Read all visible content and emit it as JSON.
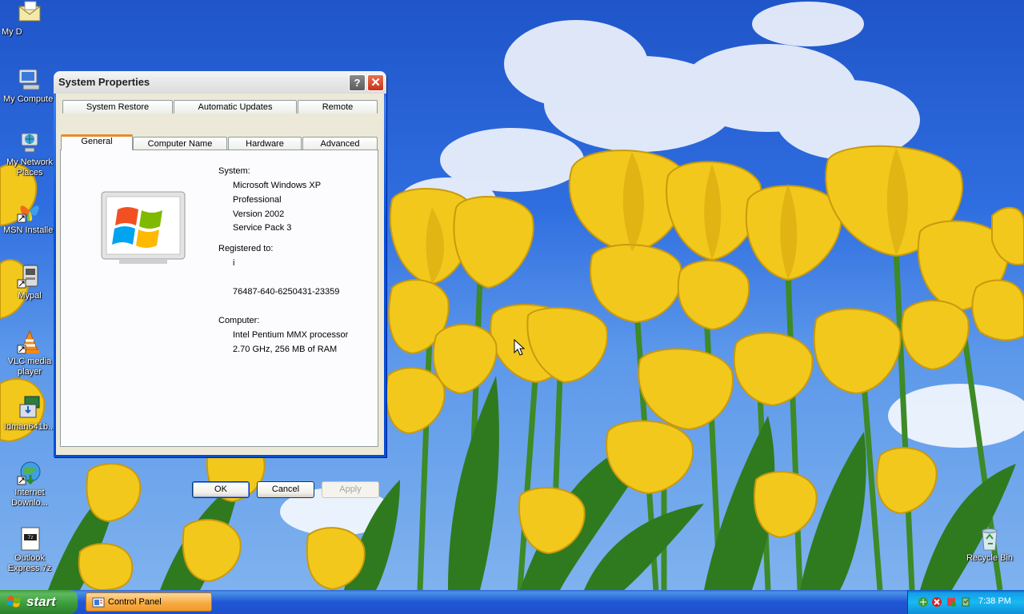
{
  "desktop": {
    "icons": [
      {
        "label": "My D"
      },
      {
        "label": "My Computer"
      },
      {
        "label": "My Network Places"
      },
      {
        "label": "MSN Installer"
      },
      {
        "label": "Mypal"
      },
      {
        "label": "VLC media player"
      },
      {
        "label": "Idman641b..."
      },
      {
        "label": "Internet Downlo..."
      },
      {
        "label": "Outlook Express.7z"
      },
      {
        "label": "Recycle Bin"
      }
    ]
  },
  "dialog": {
    "title": "System Properties",
    "help_label": "?",
    "close_label": "✕",
    "tabs_row1": [
      "System Restore",
      "Automatic Updates",
      "Remote"
    ],
    "tabs_row2": [
      "General",
      "Computer Name",
      "Hardware",
      "Advanced"
    ],
    "active_tab": "General",
    "system_heading": "System:",
    "system_lines": [
      "Microsoft Windows XP",
      "Professional",
      "Version 2002",
      "Service Pack 3"
    ],
    "registered_heading": "Registered to:",
    "registered_name": "i",
    "product_id": "76487-640-6250431-23359",
    "computer_heading": "Computer:",
    "computer_lines": [
      "Intel Pentium MMX processor",
      "2.70 GHz, 256 MB of RAM"
    ],
    "buttons": {
      "ok": "OK",
      "cancel": "Cancel",
      "apply": "Apply"
    }
  },
  "taskbar": {
    "start_label": "start",
    "task_label": "Control Panel",
    "clock": "7:38 PM"
  },
  "colors": {
    "sky": "#2f6ee0",
    "tulip": "#f2c81c",
    "dialog_face": "#ece9d8",
    "taskbar": "#2157d7",
    "start_green": "#3a9b3a"
  }
}
